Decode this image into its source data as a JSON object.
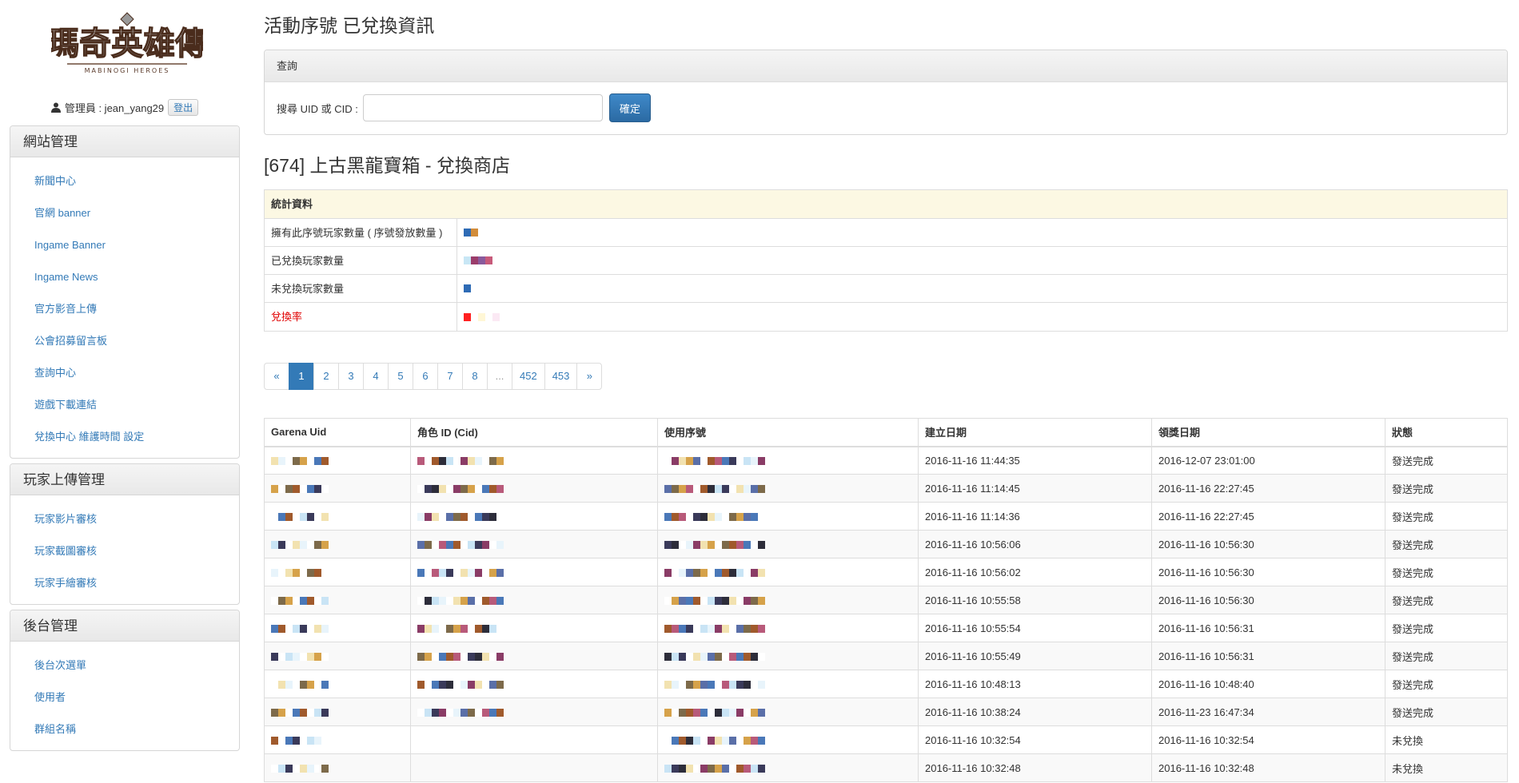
{
  "sidebar": {
    "logo_text": "瑪奇英雄傳",
    "logo_subtext": "MABINOGI HEROES",
    "admin_label": "管理員 : jean_yang29",
    "logout": "登出",
    "sections": [
      {
        "title": "網站管理",
        "items": [
          "新聞中心",
          "官網 banner",
          "Ingame Banner",
          "Ingame News",
          "官方影音上傳",
          "公會招募留言板",
          "查詢中心",
          "遊戲下載連結",
          "兌換中心 維護時間 設定"
        ]
      },
      {
        "title": "玩家上傳管理",
        "items": [
          "玩家影片審核",
          "玩家截圖審核",
          "玩家手繪審核"
        ]
      },
      {
        "title": "後台管理",
        "items": [
          "後台次選單",
          "使用者",
          "群組名稱"
        ]
      }
    ]
  },
  "main": {
    "page_title": "活動序號 已兌換資訊",
    "query": {
      "heading": "查詢",
      "label": "搜尋 UID 或 CID :",
      "placeholder": "",
      "submit": "確定"
    },
    "section_title": "[674] 上古黑龍寶箱 - 兌換商店",
    "stats": {
      "heading": "統計資料",
      "rows": [
        {
          "label": "擁有此序號玩家數量 ( 序號發放數量 )",
          "red": false
        },
        {
          "label": "已兌換玩家數量",
          "red": false
        },
        {
          "label": "未兌換玩家數量",
          "red": false
        },
        {
          "label": "兌換率",
          "red": true
        }
      ]
    },
    "pagination": [
      "«",
      "1",
      "2",
      "3",
      "4",
      "5",
      "6",
      "7",
      "8",
      "...",
      "452",
      "453",
      "»"
    ],
    "table": {
      "headers": [
        "Garena Uid",
        "角色 ID (Cid)",
        "使用序號",
        "建立日期",
        "領獎日期",
        "狀態"
      ],
      "rows": [
        {
          "created": "2016-11-16 11:44:35",
          "claimed": "2016-12-07 23:01:00",
          "status": "發送完成"
        },
        {
          "created": "2016-11-16 11:14:45",
          "claimed": "2016-11-16 22:27:45",
          "status": "發送完成"
        },
        {
          "created": "2016-11-16 11:14:36",
          "claimed": "2016-11-16 22:27:45",
          "status": "發送完成"
        },
        {
          "created": "2016-11-16 10:56:06",
          "claimed": "2016-11-16 10:56:30",
          "status": "發送完成"
        },
        {
          "created": "2016-11-16 10:56:02",
          "claimed": "2016-11-16 10:56:30",
          "status": "發送完成"
        },
        {
          "created": "2016-11-16 10:55:58",
          "claimed": "2016-11-16 10:56:30",
          "status": "發送完成"
        },
        {
          "created": "2016-11-16 10:55:54",
          "claimed": "2016-11-16 10:56:31",
          "status": "發送完成"
        },
        {
          "created": "2016-11-16 10:55:49",
          "claimed": "2016-11-16 10:56:31",
          "status": "發送完成"
        },
        {
          "created": "2016-11-16 10:48:13",
          "claimed": "2016-11-16 10:48:40",
          "status": "發送完成"
        },
        {
          "created": "2016-11-16 10:38:24",
          "claimed": "2016-11-23 16:47:34",
          "status": "發送完成"
        },
        {
          "created": "2016-11-16 10:32:54",
          "claimed": "2016-11-16 10:32:54",
          "status": "未兌換"
        },
        {
          "created": "2016-11-16 10:32:48",
          "claimed": "2016-11-16 10:32:48",
          "status": "未兌換"
        }
      ]
    }
  },
  "colors": {
    "link": "#337ab7",
    "primary": "#2f71ad",
    "warning_bg": "#fcf8e3",
    "red": "#e00000"
  }
}
